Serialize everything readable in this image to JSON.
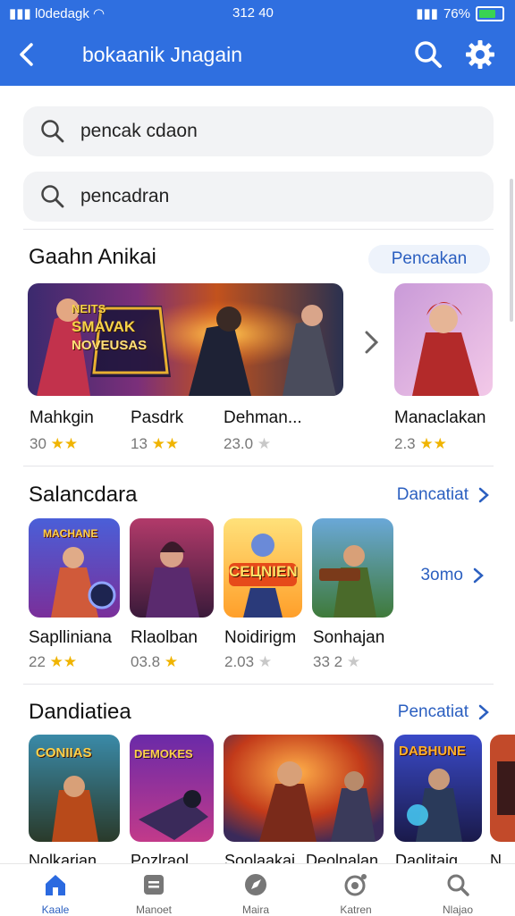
{
  "status": {
    "carrier": "l0dedagk",
    "time": "312 40",
    "battery": "76%"
  },
  "header": {
    "title": "bokaanik Jnagain"
  },
  "searches": [
    {
      "text": "pencak cdaon"
    },
    {
      "text": "pencadran"
    }
  ],
  "sections": [
    {
      "title": "Gaahn Anikai",
      "action": "Pencakan",
      "banner_text": [
        "NEITS",
        "SMAVAK",
        "NOVEUSAS"
      ],
      "items": [
        {
          "label": "Mahkgin",
          "rating": "30",
          "stars": "★★"
        },
        {
          "label": "Pasdrk",
          "rating": "13",
          "stars": "★★"
        },
        {
          "label": "Dehman...",
          "rating": "23.0",
          "stars": "★"
        },
        {
          "label": "Manaclakan",
          "rating": "2.3",
          "stars": "★★"
        }
      ]
    },
    {
      "title": "Salancdara",
      "action": "Dancatiat",
      "more": "3omo",
      "art_text": [
        "MACHANE",
        "CEЦNIEN"
      ],
      "items": [
        {
          "label": "Saplliniana",
          "rating": "22",
          "stars": "★★"
        },
        {
          "label": "Rlaolban",
          "rating": "03.8",
          "stars": "★"
        },
        {
          "label": "Noidirigm",
          "rating": "2.03",
          "stars": "★"
        },
        {
          "label": "Sonhajan",
          "rating": "33 2",
          "stars": "★"
        }
      ]
    },
    {
      "title": "Dandiatiea",
      "action": "Pencatiat",
      "art_text": [
        "CONIIAS",
        "DEMOKES",
        "DABHUNE"
      ],
      "items": [
        {
          "label": "Nolkarian"
        },
        {
          "label": "Pozlraol"
        },
        {
          "label": "Soolaakai"
        },
        {
          "label": "Deolnalan"
        },
        {
          "label": "Daolitaig"
        },
        {
          "label": "N"
        }
      ]
    }
  ],
  "bottom_nav": [
    {
      "label": "Kaale",
      "icon": "home-icon",
      "active": true
    },
    {
      "label": "Manoet",
      "icon": "library-icon",
      "active": false
    },
    {
      "label": "Maira",
      "icon": "compass-icon",
      "active": false
    },
    {
      "label": "Katren",
      "icon": "gamepad-icon",
      "active": false
    },
    {
      "label": "Nlajao",
      "icon": "search-icon",
      "active": false
    }
  ],
  "colors": {
    "primary": "#2f6fe0",
    "accent": "#2b5fc0",
    "star": "#f0b400"
  }
}
